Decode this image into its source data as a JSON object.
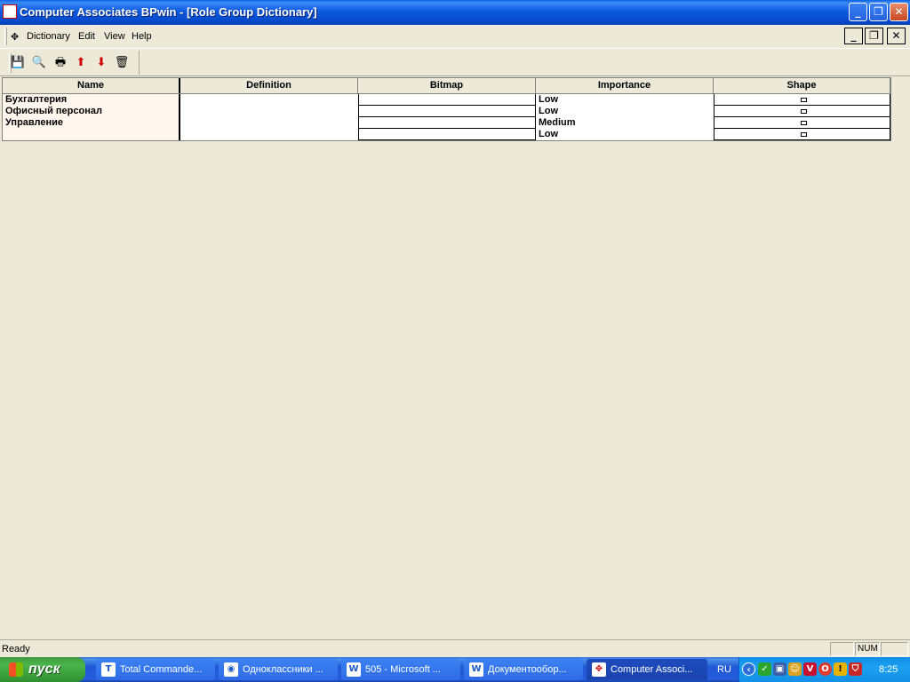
{
  "window": {
    "title": "Computer Associates BPwin - [Role Group Dictionary]",
    "minimize_glyph": "_",
    "restore_glyph": "❐",
    "close_glyph": "✕"
  },
  "menu": {
    "items": [
      "Dictionary",
      "Edit",
      "View",
      "Help"
    ],
    "mdi_minimize": "_",
    "mdi_restore": "❐",
    "mdi_close": "✕"
  },
  "toolbar": {
    "buttons": [
      {
        "name": "save-icon",
        "glyph": "💾"
      },
      {
        "name": "print-preview-icon",
        "glyph": "🔍"
      },
      {
        "name": "print-icon",
        "glyph": "🖶"
      },
      {
        "name": "import-icon",
        "glyph": "⬆"
      },
      {
        "name": "export-icon",
        "glyph": "⬇"
      },
      {
        "name": "delete-icon",
        "glyph": "🗑"
      }
    ]
  },
  "grid": {
    "columns": [
      "Name",
      "Definition",
      "Bitmap",
      "Importance",
      "Shape"
    ],
    "rows": [
      {
        "name": "Бухгалтерия",
        "definition": "",
        "bitmap": "",
        "importance": "Low"
      },
      {
        "name": "Офисный персонал",
        "definition": "",
        "bitmap": "",
        "importance": "Low"
      },
      {
        "name": "Управление",
        "definition": "",
        "bitmap": "",
        "importance": "Medium"
      },
      {
        "name": "",
        "definition": "",
        "bitmap": "",
        "importance": "Low"
      }
    ]
  },
  "statusbar": {
    "text": "Ready",
    "num": "NUM"
  },
  "taskbar": {
    "start_label": "пуск",
    "tasks": [
      {
        "label": "Total Commande...",
        "icon": "T"
      },
      {
        "label": "Одноклассники ...",
        "icon": "◉"
      },
      {
        "label": "505 - Microsoft ...",
        "icon": "W"
      },
      {
        "label": "Документообор...",
        "icon": "W"
      },
      {
        "label": "Computer Associ...",
        "icon": "✥"
      }
    ],
    "language": "RU",
    "clock": "8:25"
  }
}
